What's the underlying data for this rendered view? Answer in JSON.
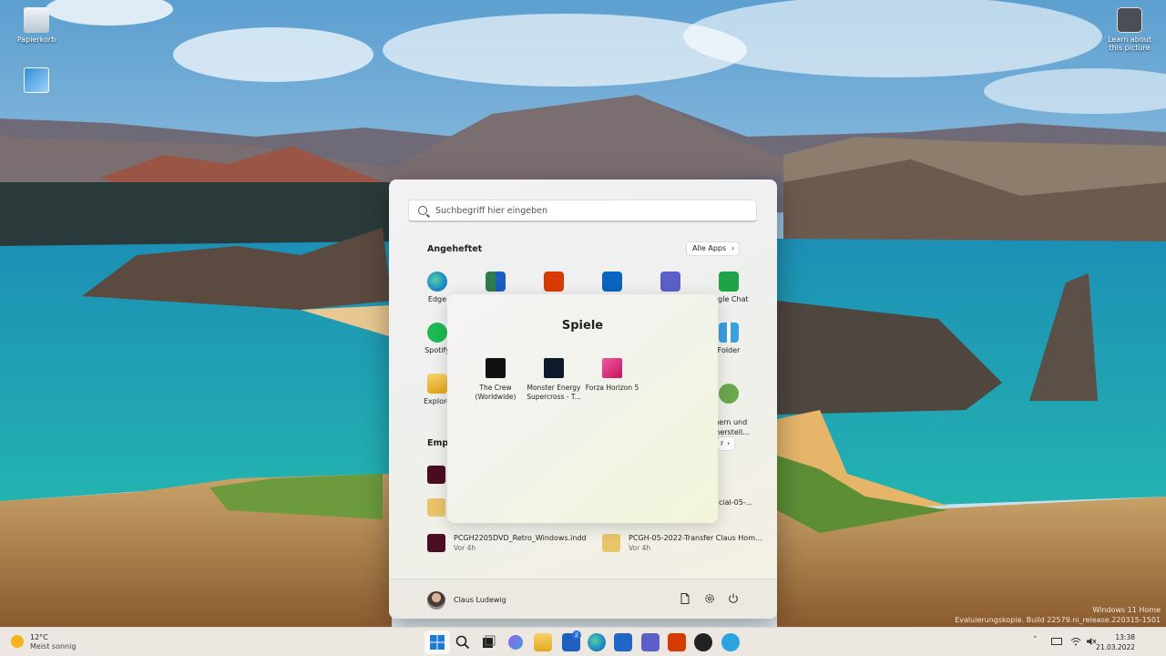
{
  "desktop": {
    "icons": [
      {
        "label": "Papierkorb",
        "icon": "recycle-bin-icon"
      },
      {
        "label": "",
        "icon": "control-panel-icon"
      },
      {
        "label": "Learn about this picture",
        "icon": "camera-icon"
      }
    ],
    "watermark": {
      "line1": "Windows 11 Home",
      "line2": "Evaluierungskopie. Build 22579.ni_release.220315-1501"
    }
  },
  "start_menu": {
    "search_placeholder": "Suchbegriff hier eingeben",
    "pinned_title": "Angeheftet",
    "all_apps_label": "Alle Apps",
    "pinned": [
      {
        "label": "Edge",
        "icon": "edge-icon",
        "color": "#1e88c8"
      },
      {
        "label": "",
        "icon": "office-folder-icon",
        "color": "#2f7d4e"
      },
      {
        "label": "",
        "icon": "office-icon",
        "color": "#d83b01"
      },
      {
        "label": "",
        "icon": "outlook-icon",
        "color": "#0a64c2"
      },
      {
        "label": "",
        "icon": "teams-icon",
        "color": "#5b5fc7"
      },
      {
        "label": "oogle Chat",
        "icon": "google-chat-icon",
        "color": "#1ea446"
      },
      {
        "label": "Spotify",
        "icon": "spotify-icon",
        "color": "#1db954"
      },
      {
        "label": "Folder",
        "icon": "apps-folder-icon",
        "color": "#3aa0e0"
      },
      {
        "label": "Explore",
        "icon": "file-explorer-icon",
        "color": "#f2b521"
      },
      {
        "label": "chern und\nerherstell...",
        "icon": "backup-restore-icon",
        "color": "#6aa84f"
      }
    ],
    "recommended_title": "Empf",
    "more_label": "r",
    "recommended": [
      {
        "name": "",
        "time": "",
        "icon": "indesign-icon",
        "color": "#4a0d21"
      },
      {
        "name": "",
        "time": "",
        "icon": "folder-icon",
        "color": "#e9c46a"
      },
      {
        "name": "cial-05-...",
        "time": "",
        "icon": "",
        "color": ""
      },
      {
        "name": "PCGH2205DVD_Retro_Windows.indd",
        "time": "Vor 4h",
        "icon": "indesign-icon",
        "color": "#4a0d21"
      },
      {
        "name": "PCGH-05-2022-Transfer Claus Hom...",
        "time": "Vor 4h",
        "icon": "folder-icon",
        "color": "#e9c46a"
      }
    ],
    "user_name": "Claus Ludewig"
  },
  "folder_popup": {
    "title": "Spiele",
    "games": [
      {
        "label": "The Crew (Worldwide)",
        "icon": "the-crew-icon",
        "color": "#111111"
      },
      {
        "label": "Monster Energy Supercross - T...",
        "icon": "supercross-icon",
        "color": "#0d1a2b"
      },
      {
        "label": "Forza Horizon 5",
        "icon": "forza-icon",
        "color": "#e2267b"
      }
    ]
  },
  "taskbar": {
    "weather_temp": "12°C",
    "weather_condition": "Meist sonnig",
    "badge_count": "2",
    "time": "13:38",
    "date": "21.03.2022",
    "icons": [
      "start-icon",
      "search-icon",
      "task-view-icon",
      "snipping-icon",
      "file-explorer-icon",
      "store-badge-icon",
      "edge-icon",
      "ms-store-icon",
      "teams-icon",
      "office-icon",
      "media-player-icon",
      "telegram-icon"
    ]
  }
}
